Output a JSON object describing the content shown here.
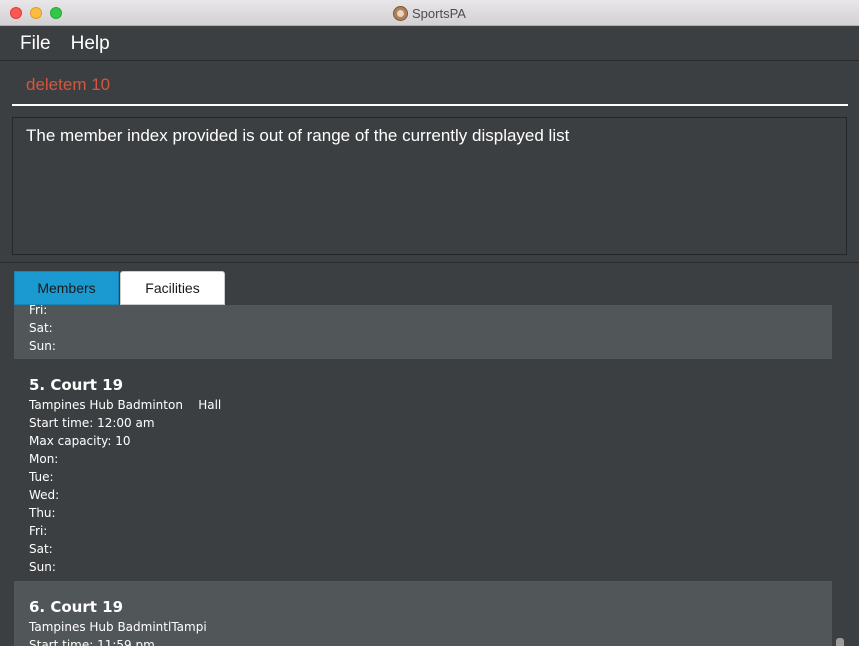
{
  "window": {
    "title": "SportsPA"
  },
  "menu": {
    "file": "File",
    "help": "Help"
  },
  "command": {
    "value": "deletem 10"
  },
  "result": {
    "message": "The member index provided is out of range of the currently displayed list"
  },
  "tabs": [
    {
      "label": "Members",
      "active": true
    },
    {
      "label": "Facilities",
      "active": false
    }
  ],
  "colors": {
    "accent": "#1b9ad1",
    "command_text": "#d5563e",
    "background": "#3c3f41",
    "card_alt": "#515658"
  },
  "cards": [
    {
      "lines": [
        "Fri:",
        "Sat:",
        "Sun:"
      ]
    },
    {
      "title": "5. Court 19",
      "lines": [
        "Tampines Hub Badminton    Hall",
        "Start time: 12:00 am",
        "Max capacity: 10",
        "Mon:",
        "Tue:",
        "Wed:",
        "Thu:",
        "Fri:",
        "Sat:",
        "Sun:"
      ]
    },
    {
      "title": "6. Court 19",
      "lines": [
        "Tampines Hub BadmintlTampi",
        "Start time: 11:59 pm"
      ]
    }
  ]
}
